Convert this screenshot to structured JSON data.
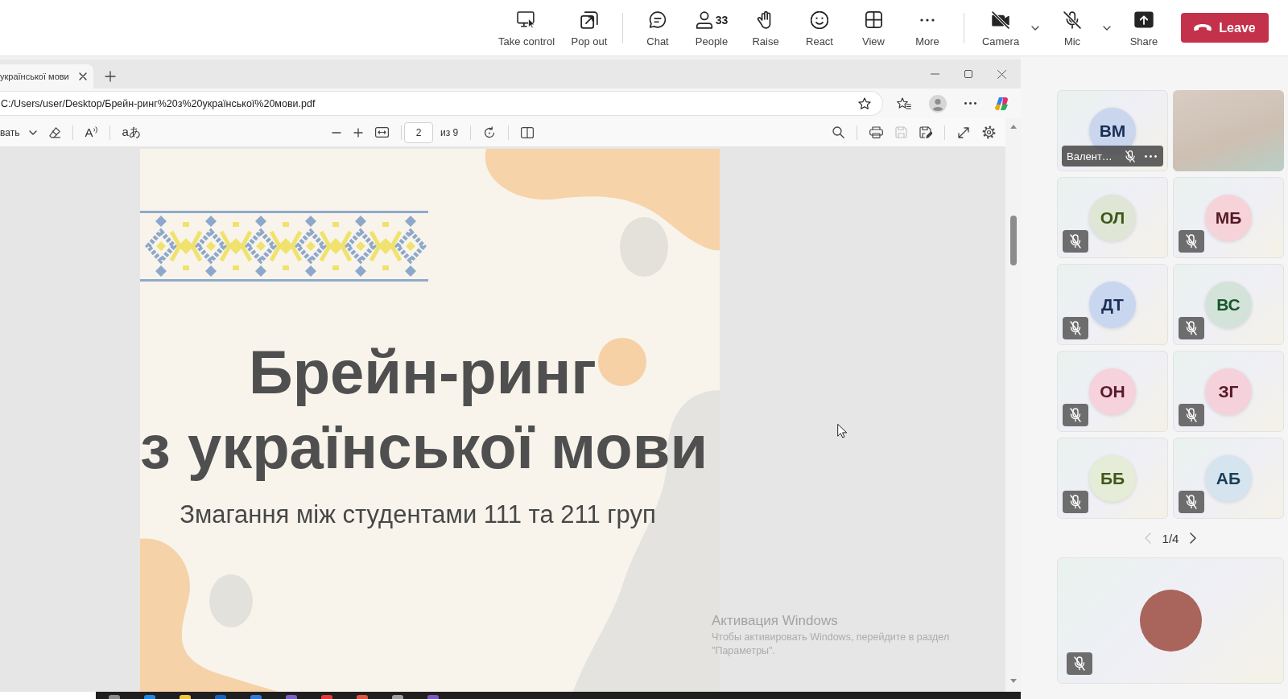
{
  "meeting_toolbar": {
    "button_groups": [
      {
        "buttons": [
          {
            "kind": "take_control",
            "label": "Take control"
          },
          {
            "kind": "pop_out",
            "label": "Pop out"
          }
        ]
      },
      {
        "buttons": [
          {
            "kind": "chat",
            "label": "Chat"
          },
          {
            "kind": "people",
            "label": "People",
            "count": "33"
          },
          {
            "kind": "raise",
            "label": "Raise"
          },
          {
            "kind": "react",
            "label": "React"
          },
          {
            "kind": "view",
            "label": "View"
          },
          {
            "kind": "more",
            "label": "More"
          }
        ]
      },
      {
        "buttons": [
          {
            "kind": "camera",
            "label": "Camera",
            "on": false,
            "menu": true
          },
          {
            "kind": "mic",
            "label": "Mic",
            "on": false,
            "menu": true
          },
          {
            "kind": "share",
            "label": "Share"
          }
        ]
      }
    ],
    "leave_button": "Leave"
  },
  "browser": {
    "tab_title": "української мови",
    "address": "C:/Users/user/Desktop/Брейн-ринг%20з%20української%20мови.pdf"
  },
  "pdf_toolbar": {
    "draw_button": "вать",
    "read_aloud_button": "A",
    "translate_button": "aあ",
    "page": "2",
    "page_count": "из 9",
    "save_disabled": true
  },
  "slide": {
    "title_lines": [
      "Брейн-ринг",
      "з української мови"
    ],
    "subtitle": "Змагання між студентами 111 та 211 груп"
  },
  "activation_notice": {
    "title": "Активация Windows",
    "text": "Чтобы активировать Windows, перейдите в раздел \"Параметры\"."
  },
  "participants": {
    "tiles": [
      {
        "kind": "avatar",
        "initials": "ВМ",
        "color": "#cad6ee",
        "name": "Валент…",
        "muted": true
      },
      {
        "kind": "video"
      },
      {
        "kind": "avatar",
        "initials": "ОЛ",
        "color": "#dfe6d6",
        "muted": true
      },
      {
        "kind": "avatar",
        "initials": "МБ",
        "color": "#f5d3d8",
        "muted": true
      },
      {
        "kind": "avatar",
        "initials": "ДТ",
        "color": "#c9d6ef",
        "muted": true
      },
      {
        "kind": "avatar",
        "initials": "ВС",
        "color": "#d4e3d9",
        "muted": true
      },
      {
        "kind": "avatar",
        "initials": "ОН",
        "color": "#f6d2dc",
        "muted": true
      },
      {
        "kind": "avatar",
        "initials": "ЗГ",
        "color": "#f5d2db",
        "muted": true
      },
      {
        "kind": "avatar",
        "initials": "ББ",
        "color": "#e5ecd7",
        "muted": true
      },
      {
        "kind": "avatar",
        "initials": "АБ",
        "color": "#d5e4ee",
        "muted": true
      }
    ],
    "pagination": {
      "label": "1/4",
      "prev_disabled": true
    },
    "self_tile": {
      "kind": "photo",
      "muted": true
    }
  }
}
